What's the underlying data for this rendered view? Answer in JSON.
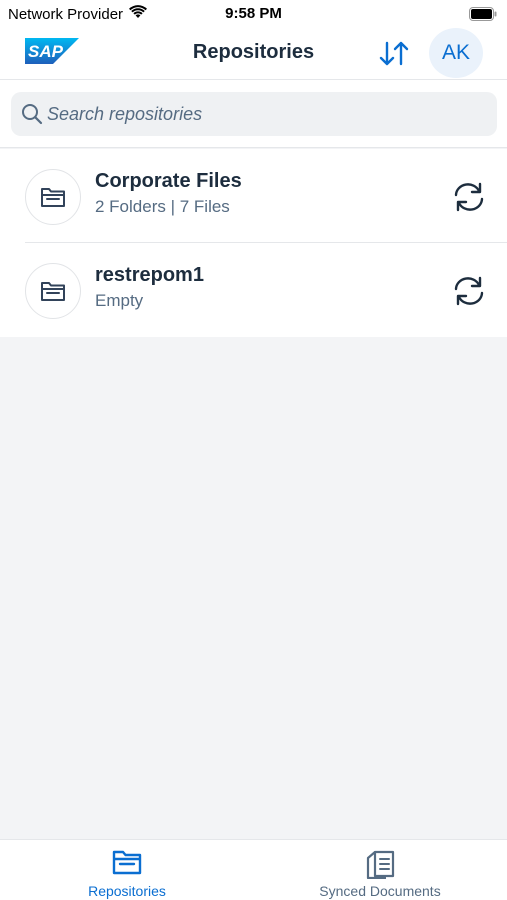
{
  "status_bar": {
    "carrier": "Network Provider",
    "time": "9:58 PM"
  },
  "nav": {
    "logo_text": "SAP",
    "title": "Repositories",
    "avatar_initials": "AK"
  },
  "search": {
    "placeholder": "Search repositories",
    "value": ""
  },
  "repositories": [
    {
      "name": "Corporate Files",
      "detail": "2 Folders | 7 Files"
    },
    {
      "name": "restrepom1",
      "detail": "Empty"
    }
  ],
  "tabs": [
    {
      "label": "Repositories",
      "active": true
    },
    {
      "label": "Synced Documents",
      "active": false
    }
  ],
  "colors": {
    "accent": "#0a6ed1",
    "text_primary": "#1d2d3e",
    "text_secondary": "#556b82",
    "background": "#f3f4f6"
  }
}
